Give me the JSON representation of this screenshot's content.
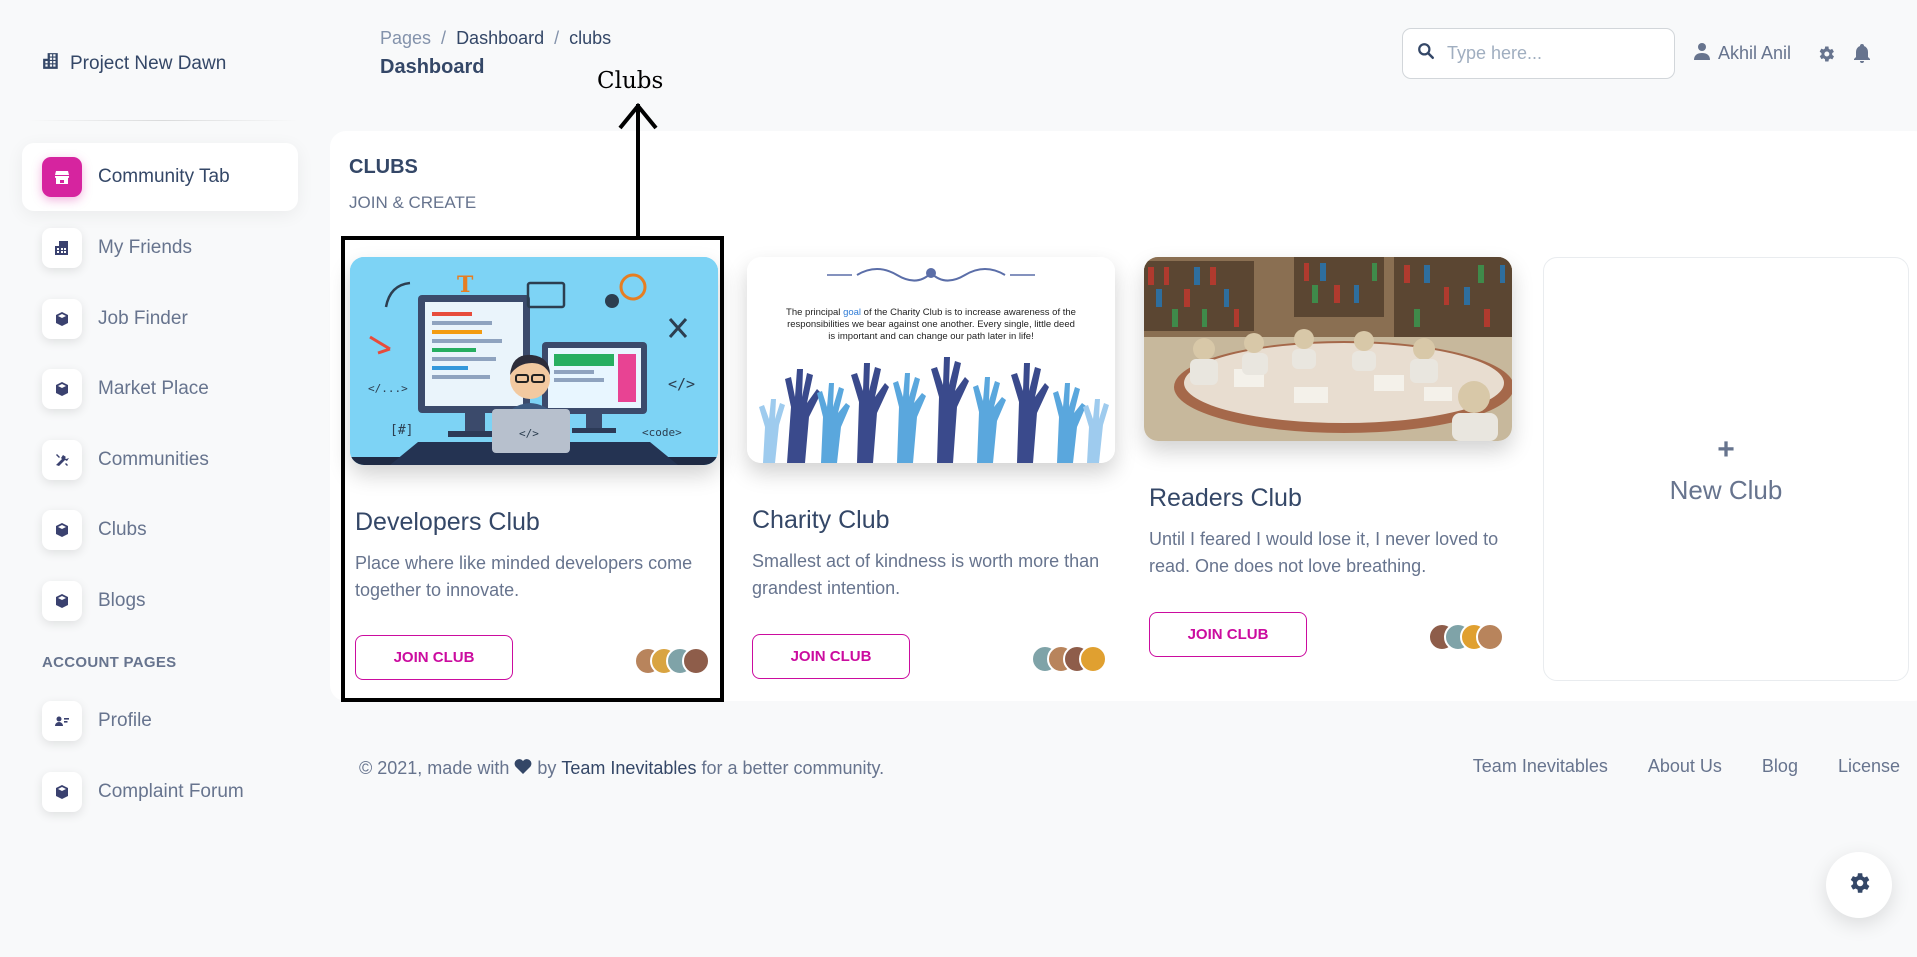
{
  "brand": {
    "name": "Project New Dawn",
    "icon": "building-icon"
  },
  "sidebar": {
    "items": [
      {
        "label": "Community Tab",
        "icon": "shop-icon",
        "active": true
      },
      {
        "label": "My Friends",
        "icon": "building-icon"
      },
      {
        "label": "Job Finder",
        "icon": "box-icon"
      },
      {
        "label": "Market Place",
        "icon": "box-icon"
      },
      {
        "label": "Communities",
        "icon": "tools-icon"
      },
      {
        "label": "Clubs",
        "icon": "box-icon"
      },
      {
        "label": "Blogs",
        "icon": "box-icon"
      }
    ],
    "section_label": "ACCOUNT PAGES",
    "account_items": [
      {
        "label": "Profile",
        "icon": "profile-icon"
      },
      {
        "label": "Complaint Forum",
        "icon": "box-icon"
      }
    ]
  },
  "header": {
    "breadcrumb": [
      "Pages",
      "/",
      "Dashboard",
      "/",
      "clubs"
    ],
    "title": "Dashboard",
    "search_placeholder": "Type here...",
    "user_name": "Akhil Anil"
  },
  "annotation": {
    "label": "Clubs"
  },
  "clubs_section": {
    "title": "CLUBS",
    "subtitle": "JOIN & CREATE",
    "clubs": [
      {
        "name": "Developers Club",
        "description": "Place where like minded developers come together to innovate.",
        "button": "JOIN CLUB",
        "image": "developer-illustration",
        "image_labels": [
          "</...>",
          "</>",
          "[#]",
          "<code>",
          "</>",
          "T"
        ]
      },
      {
        "name": "Charity Club",
        "description": "Smallest act of kindness is worth more than grandest intention.",
        "button": "JOIN CLUB",
        "image": "charity-hands-illustration",
        "image_text_before": "The principal ",
        "image_text_highlight": "goal",
        "image_text_after": " of the Charity Club is to increase awareness of the responsibilities we bear against one another. Every single, little deed is important and can change our path later in life!"
      },
      {
        "name": "Readers Club",
        "description": "Until I feared I would lose it, I never loved to read. One does not love breathing.",
        "button": "JOIN CLUB",
        "image": "library-photo"
      }
    ],
    "new_club": {
      "plus": "+",
      "label": "New Club"
    }
  },
  "footer": {
    "copyright_prefix": "© 2021, made with",
    "by": "by",
    "team": "Team Inevitables",
    "suffix": "for a better community.",
    "links": [
      "Team Inevitables",
      "About Us",
      "Blog",
      "License"
    ]
  },
  "colors": {
    "accent": "#cb0c9f",
    "text_dark": "#344767",
    "text_muted": "#67748e",
    "sky": "#7dd3f5"
  }
}
